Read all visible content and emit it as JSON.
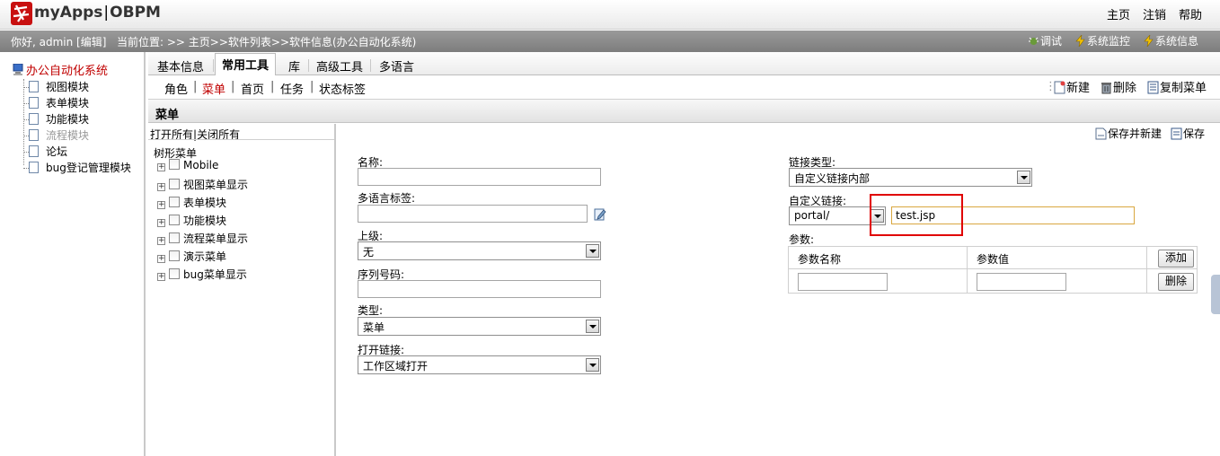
{
  "header": {
    "logo_text": "myApps",
    "logo_product": "OBPM",
    "links": [
      "主页",
      "注销",
      "帮助"
    ]
  },
  "status": {
    "greeting": "你好, admin [编辑]",
    "location": "当前位置: >> 主页>>软件列表>>软件信息(办公自动化系统)",
    "actions": [
      "调试",
      "系统监控",
      "系统信息"
    ]
  },
  "left_tree": {
    "root": "办公自动化系统",
    "items": [
      "视图模块",
      "表单模块",
      "功能模块",
      "流程模块",
      "论坛",
      "bug登记管理模块"
    ]
  },
  "tabs": {
    "items": [
      "基本信息",
      "常用工具",
      "库",
      "高级工具",
      "多语言"
    ],
    "active": "常用工具"
  },
  "subtabs": {
    "items": [
      "角色",
      "菜单",
      "首页",
      "任务",
      "状态标签"
    ],
    "active": "菜单",
    "toolbar": [
      "新建",
      "删除",
      "复制菜单"
    ]
  },
  "section": {
    "title": "菜单"
  },
  "menu_tree": {
    "open_all": "打开所有",
    "close_all": "关闭所有",
    "root": "树形菜单",
    "nodes": [
      "Mobile",
      "视图菜单显示",
      "表单模块",
      "功能模块",
      "流程菜单显示",
      "演示菜单",
      "bug菜单显示"
    ]
  },
  "form": {
    "save_new": "保存并新建",
    "save": "保存",
    "name_label": "名称:",
    "name_value": "",
    "multilang_label": "多语言标签:",
    "multilang_value": "",
    "parent_label": "上级:",
    "parent_value": "无",
    "order_label": "序列号码:",
    "order_value": "",
    "type_label": "类型:",
    "type_value": "菜单",
    "open_label": "打开链接:",
    "open_value": "工作区域打开",
    "link_type_label": "链接类型:",
    "link_type_value": "自定义链接内部",
    "custom_link_label": "自定义链接:",
    "custom_link_prefix": "portal/",
    "custom_link_value": "test.jsp",
    "params_label": "参数:",
    "param_name_header": "参数名称",
    "param_value_header": "参数值",
    "add_button": "添加",
    "delete_button": "删除",
    "param_name_value": "",
    "param_value_value": ""
  }
}
